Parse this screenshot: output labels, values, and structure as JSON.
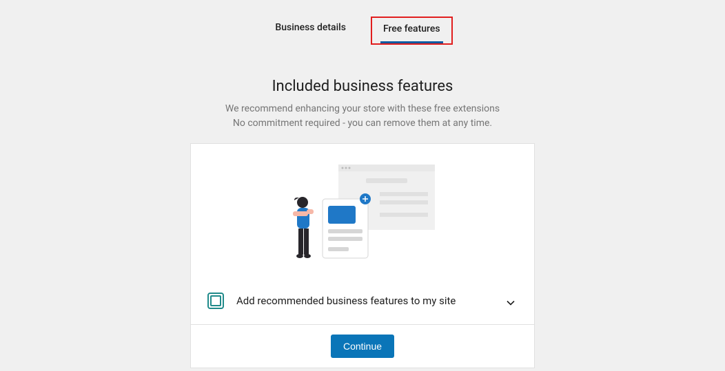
{
  "tabs": {
    "business_details": "Business details",
    "free_features": "Free features"
  },
  "header": {
    "title": "Included business features",
    "subtitle_line1": "We recommend enhancing your store with these free extensions",
    "subtitle_line2": "No commitment required - you can remove them at any time."
  },
  "option": {
    "label": "Add recommended business features to my site"
  },
  "footer": {
    "continue_label": "Continue"
  }
}
